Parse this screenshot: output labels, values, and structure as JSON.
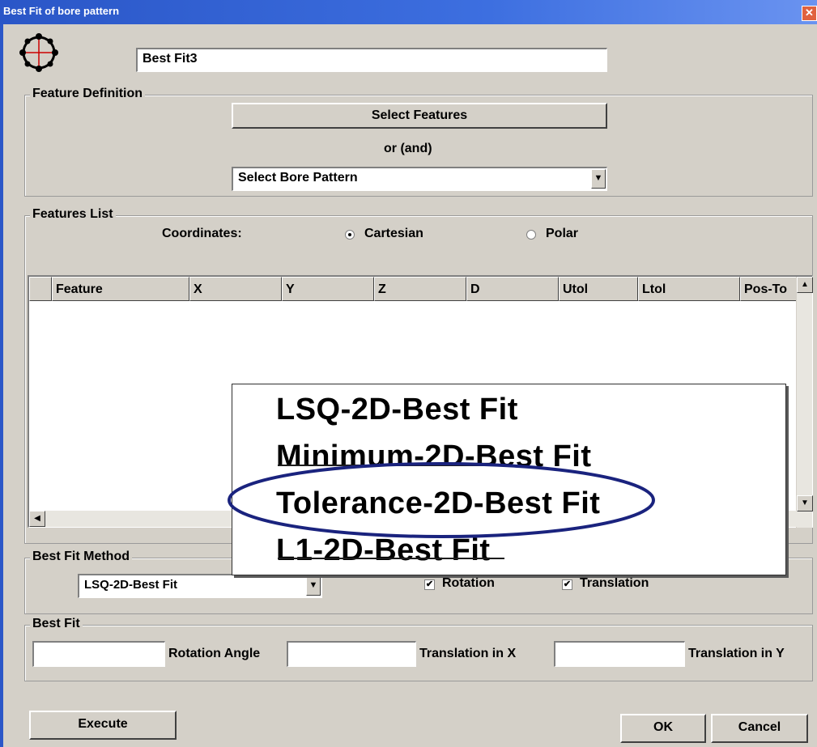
{
  "window": {
    "title": "Best Fit of bore pattern",
    "close_glyph": "✕"
  },
  "name_field": {
    "value": "Best Fit3"
  },
  "feature_definition": {
    "group_title": "Feature Definition",
    "select_features_label": "Select Features",
    "or_label": "or (and)",
    "bore_pattern_value": "Select Bore Pattern"
  },
  "features_list": {
    "group_title": "Features List",
    "coordinates_label": "Coordinates:",
    "radio_cartesian": "Cartesian",
    "radio_polar": "Polar",
    "selected": "Cartesian",
    "columns": [
      "Feature",
      "X",
      "Y",
      "Z",
      "D",
      "Utol",
      "Ltol",
      "Pos-To"
    ],
    "rows": []
  },
  "popup": {
    "options": [
      "LSQ-2D-Best Fit",
      "Minimum-2D-Best Fit",
      "Tolerance-2D-Best Fit",
      "L1-2D-Best Fit"
    ],
    "highlighted": "Tolerance-2D-Best Fit",
    "highlight_color": "#1a237e"
  },
  "best_fit_method": {
    "group_title": "Best Fit Method",
    "method_value": "LSQ-2D-Best Fit",
    "rotation_label": "Rotation",
    "rotation_checked": true,
    "translation_label": "Translation",
    "translation_checked": true
  },
  "best_fit": {
    "group_title": "Best Fit",
    "rotation_angle_label": "Rotation Angle",
    "translation_x_label": "Translation in X",
    "translation_y_label": "Translation in Y",
    "field1": "",
    "field2": "",
    "field3": ""
  },
  "buttons": {
    "execute": "Execute",
    "ok": "OK",
    "cancel": "Cancel"
  },
  "icons": {
    "window_icon": "bore-pattern-icon",
    "combo_arrow": "▼",
    "check_mark": "✔",
    "scroll_up": "▲",
    "scroll_down": "▼",
    "scroll_left": "◀"
  },
  "colors": {
    "title_bar": "#2a56c7",
    "dialog_bg": "#d4d0c8",
    "ellipse": "#1a237e"
  }
}
